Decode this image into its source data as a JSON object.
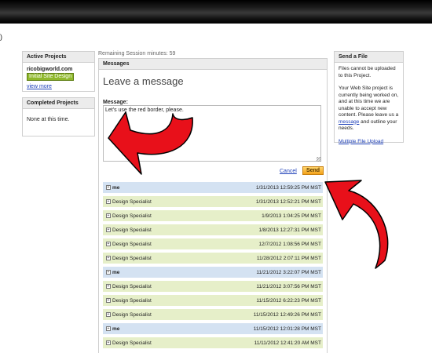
{
  "header": {
    "partial_text": ")"
  },
  "active_projects": {
    "title": "Active Projects",
    "username": "ricobigworld.com",
    "project_badge": "Initial Site Design",
    "view_more": "view more"
  },
  "completed_projects": {
    "title": "Completed Projects",
    "empty_text": "None at this time."
  },
  "session": {
    "remaining_text": "Remaining Session minutes: 59"
  },
  "messages": {
    "title": "Messages",
    "heading": "Leave a message",
    "message_label": "Message:",
    "message_value": "Let's use the red border, please.",
    "cancel_label": "Cancel",
    "send_label": "Send",
    "thread": [
      {
        "sender": "me",
        "date": "1/31/2013 12:59:25 PM MST",
        "kind": "me"
      },
      {
        "sender": "Design Specialist",
        "date": "1/31/2013 12:52:21 PM MST",
        "kind": "ds"
      },
      {
        "sender": "Design Specialist",
        "date": "1/9/2013 1:04:25 PM MST",
        "kind": "ds"
      },
      {
        "sender": "Design Specialist",
        "date": "1/8/2013 12:27:31 PM MST",
        "kind": "ds"
      },
      {
        "sender": "Design Specialist",
        "date": "12/7/2012 1:08:56 PM MST",
        "kind": "ds"
      },
      {
        "sender": "Design Specialist",
        "date": "11/28/2012 2:07:11 PM MST",
        "kind": "ds"
      },
      {
        "sender": "me",
        "date": "11/21/2012 3:22:07 PM MST",
        "kind": "me"
      },
      {
        "sender": "Design Specialist",
        "date": "11/21/2012 3:07:56 PM MST",
        "kind": "ds"
      },
      {
        "sender": "Design Specialist",
        "date": "11/15/2012 6:22:23 PM MST",
        "kind": "ds"
      },
      {
        "sender": "Design Specialist",
        "date": "11/15/2012 12:49:26 PM MST",
        "kind": "ds"
      },
      {
        "sender": "me",
        "date": "11/15/2012 12:01:28 PM MST",
        "kind": "me"
      },
      {
        "sender": "Design Specialist",
        "date": "11/11/2012 12:41:20 AM MST",
        "kind": "ds"
      }
    ]
  },
  "send_file": {
    "title": "Send a File",
    "para1": "Files cannot be uploaded to this Project.",
    "para2_before": "Your Web Site project is currently being worked on, and at this time we are unable to accept new content. Please leave us a ",
    "para2_link": "message",
    "para2_after": " and outline your needs.",
    "multi_upload": "Multiple File Upload"
  },
  "colors": {
    "arrow_fill": "#e8101a",
    "badge_green": "#8fb82c",
    "link_blue": "#1d3fb8",
    "send_orange": "#f3a21b",
    "row_me": "#d4e2f2",
    "row_ds": "#e6efc9"
  }
}
